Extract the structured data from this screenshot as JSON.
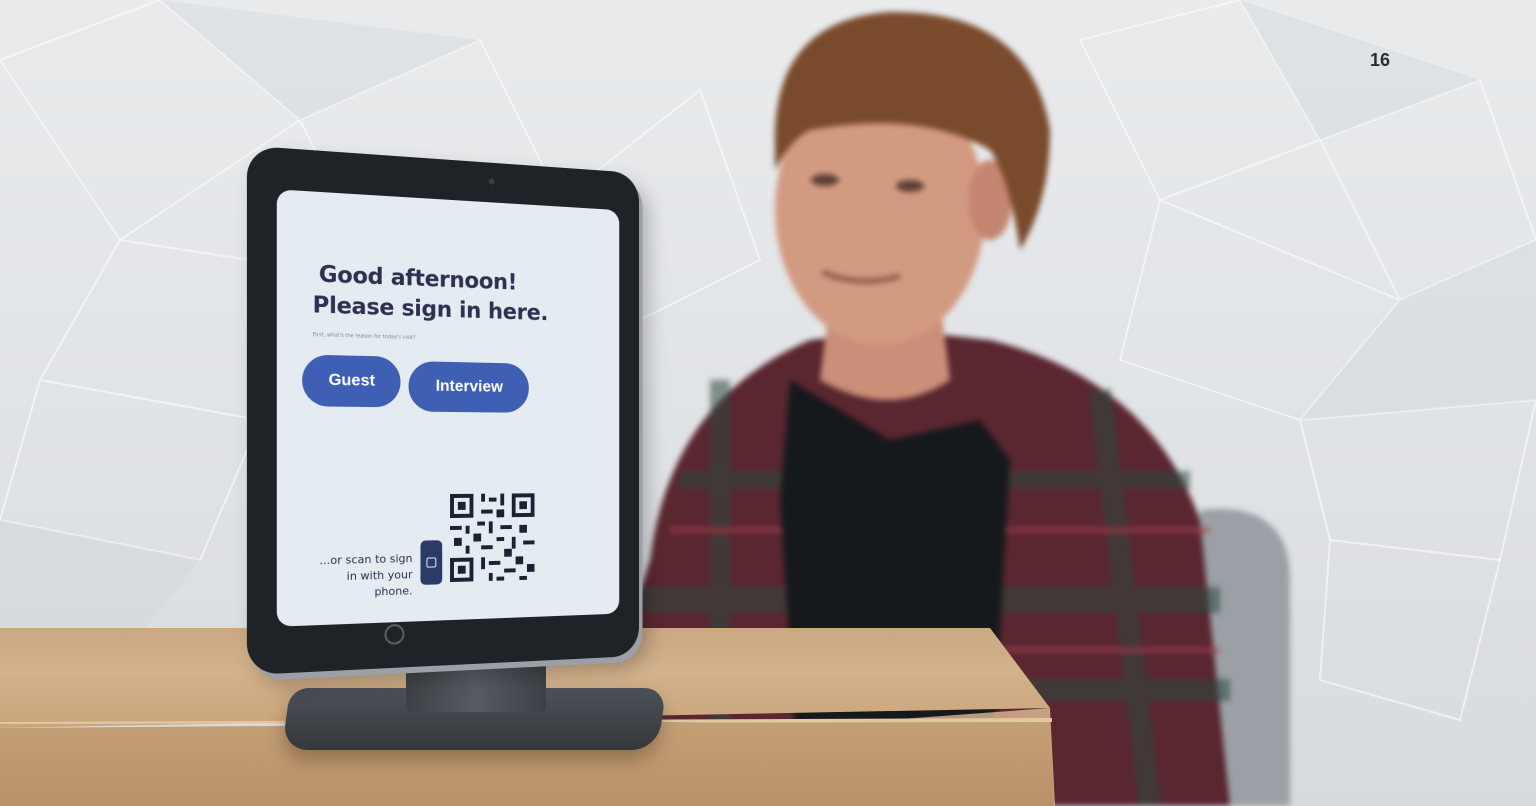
{
  "page": {
    "number": "16"
  },
  "kiosk": {
    "greeting_line1": "Good afternoon!",
    "greeting_line2": "Please sign in here.",
    "reason_prompt": "First, what's the reason for today's visit?",
    "guest_button": "Guest",
    "interview_button": "Interview",
    "scan_prompt": "...or scan to sign in with your phone.",
    "accent_color": "#3e5fb3",
    "screen_color": "#e4ecf2",
    "icons": [
      "phone-icon",
      "qr-code-icon",
      "camera-icon",
      "home-button-icon"
    ]
  },
  "colors": {
    "wall": "#e2e5e8",
    "desk": "#c9a57c",
    "shirt_red": "#7a2530",
    "shirt_green": "#2c4a3f",
    "tshirt": "#16191c"
  }
}
